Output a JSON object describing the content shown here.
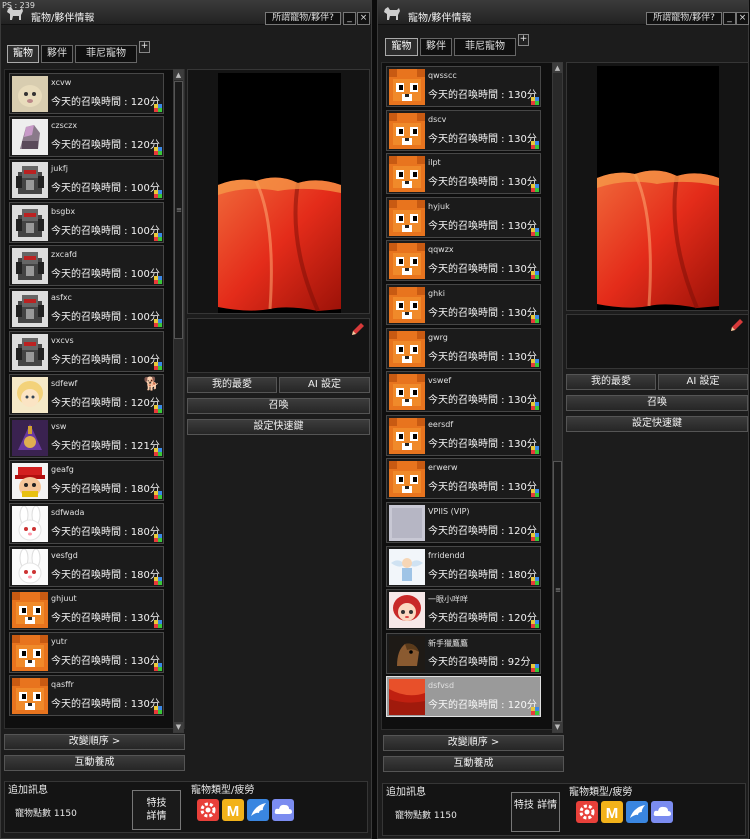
{
  "fps": "PS : 239",
  "window": {
    "title": "寵物/夥伴情報",
    "owned_button": "所謂寵物/夥伴?",
    "minimize": "_",
    "close": "×",
    "tabs": [
      "寵物",
      "夥伴",
      "菲尼寵物"
    ],
    "tab_plus": "+"
  },
  "left_list": [
    {
      "name": "xcvw",
      "time": "今天的召喚時間 : 120分",
      "thumb": "cream"
    },
    {
      "name": "czsczx",
      "time": "今天的召喚時間 : 120分",
      "thumb": "knight"
    },
    {
      "name": "jukfj",
      "time": "今天的召喚時間 : 100分",
      "thumb": "armor"
    },
    {
      "name": "bsgbx",
      "time": "今天的召喚時間 : 100分",
      "thumb": "armor"
    },
    {
      "name": "zxcafd",
      "time": "今天的召喚時間 : 100分",
      "thumb": "armor"
    },
    {
      "name": "asfxc",
      "time": "今天的召喚時間 : 100分",
      "thumb": "armor"
    },
    {
      "name": "vxcvs",
      "time": "今天的召喚時間 : 100分",
      "thumb": "armor"
    },
    {
      "name": "sdfewf",
      "time": "今天的召喚時間 : 120分",
      "thumb": "blond",
      "badge": "🐕"
    },
    {
      "name": "vsw",
      "time": "今天的召喚時間 : 121分",
      "thumb": "mage"
    },
    {
      "name": "geafg",
      "time": "今天的召喚時間 : 180分",
      "thumb": "hat"
    },
    {
      "name": "sdfwada",
      "time": "今天的召喚時間 : 180分",
      "thumb": "bunny"
    },
    {
      "name": "vesfgd",
      "time": "今天的召喚時間 : 180分",
      "thumb": "bunny"
    },
    {
      "name": "ghjuut",
      "time": "今天的召喚時間 : 130分",
      "thumb": "fox"
    },
    {
      "name": "yutr",
      "time": "今天的召喚時間 : 130分",
      "thumb": "fox"
    },
    {
      "name": "qasffr",
      "time": "今天的召喚時間 : 130分",
      "thumb": "fox"
    }
  ],
  "right_list": [
    {
      "name": "qwsscc",
      "time": "今天的召喚時間 : 130分",
      "thumb": "fox"
    },
    {
      "name": "dscv",
      "time": "今天的召喚時間 : 130分",
      "thumb": "fox"
    },
    {
      "name": "ilpt",
      "time": "今天的召喚時間 : 130分",
      "thumb": "fox"
    },
    {
      "name": "hyjuk",
      "time": "今天的召喚時間 : 130分",
      "thumb": "fox"
    },
    {
      "name": "qqwzx",
      "time": "今天的召喚時間 : 130分",
      "thumb": "fox"
    },
    {
      "name": "ghki",
      "time": "今天的召喚時間 : 130分",
      "thumb": "fox"
    },
    {
      "name": "gwrg",
      "time": "今天的召喚時間 : 130分",
      "thumb": "fox"
    },
    {
      "name": "vswef",
      "time": "今天的召喚時間 : 130分",
      "thumb": "fox"
    },
    {
      "name": "eersdf",
      "time": "今天的召喚時間 : 130分",
      "thumb": "fox"
    },
    {
      "name": "erwerw",
      "time": "今天的召喚時間 : 130分",
      "thumb": "fox"
    },
    {
      "name": "VPIIS (VIP)",
      "time": "今天的召喚時間 : 120分",
      "thumb": "white"
    },
    {
      "name": "frridendd",
      "time": "今天的召喚時間 : 180分",
      "thumb": "angel"
    },
    {
      "name": "一眼小咩咩",
      "time": "今天的召喚時間 : 120分",
      "thumb": "girl"
    },
    {
      "name": "新手獵鷹鷹",
      "time": "今天的召喚時間 : 92分",
      "thumb": "horse"
    },
    {
      "name": "dsfvsd",
      "time": "今天的召喚時間 : 120分",
      "thumb": "red",
      "selected": true
    }
  ],
  "actions": {
    "favorite": "我的最愛",
    "ai_settings": "AI 設定",
    "summon": "召喚",
    "hotkey": "設定快速鍵",
    "change_order": "改變順序 >",
    "interact": "互動養成"
  },
  "info": {
    "extra_label": "追加訊息",
    "points_label": "寵物點數",
    "points_value": "1150",
    "skill_button": "特技\n詳情",
    "type_label": "寵物類型/疲勞",
    "type_icons": [
      "gear-icon",
      "m-icon",
      "wing-icon",
      "cloud-icon"
    ]
  },
  "colors": {
    "gear": "#e8403a",
    "m": "#f2b21a",
    "wing": "#3a86e0",
    "cloud": "#7b8cf0"
  }
}
